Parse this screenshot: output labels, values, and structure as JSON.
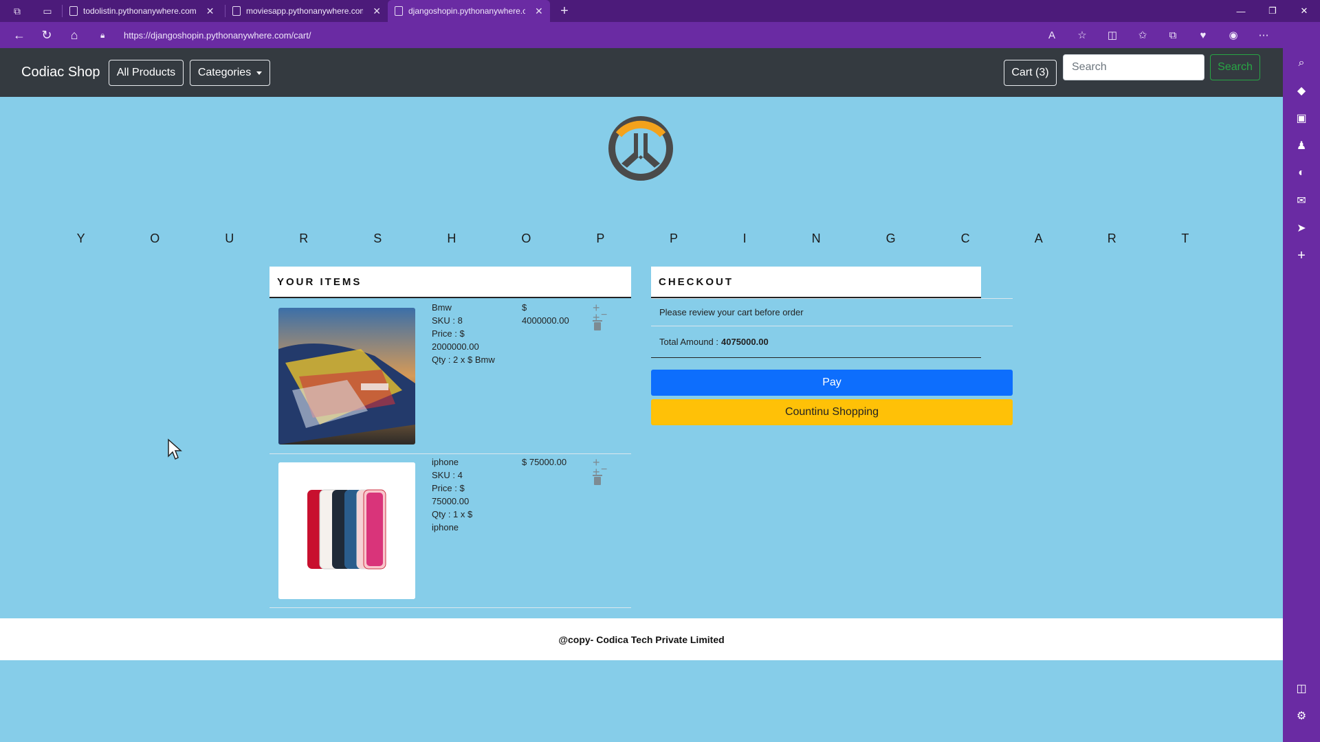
{
  "browser": {
    "tabs": [
      {
        "title": "todolistin.pythonanywhere.com"
      },
      {
        "title": "moviesapp.pythonanywhere.com"
      },
      {
        "title": "djangoshopin.pythonanywhere.c"
      }
    ],
    "url": "https://djangoshopin.pythonanywhere.com/cart/"
  },
  "navbar": {
    "brand": "Codiac Shop",
    "all_products": "All Products",
    "categories": "Categories",
    "cart": "Cart (3)",
    "search_placeholder": "Search",
    "search_button": "Search"
  },
  "main": {
    "title": "Y O U R   S H O P P I N G   C A R T",
    "items_heading": "YOUR ITEMS",
    "items": [
      {
        "name": "Bmw",
        "sku": "SKU : 8",
        "price_label": "Price : $",
        "price_value": "2000000.00",
        "qty": "Qty : 2 x $ Bmw",
        "total_prefix": "$",
        "total": "4000000.00"
      },
      {
        "name": "iphone",
        "sku": "SKU : 4",
        "price_label": "Price : $",
        "price_value": "75000.00",
        "qty": "Qty : 1 x $",
        "qty2": "iphone",
        "total": "$ 75000.00"
      }
    ],
    "checkout": {
      "heading": "CHECKOUT",
      "review": "Please review your cart before order",
      "total_label": "Total Amound : ",
      "total_value": "4075000.00",
      "pay": "Pay",
      "continue": "Countinu Shopping"
    }
  },
  "footer": {
    "text": "@copy- Codica Tech Private Limited"
  },
  "colors": {
    "page_bg": "#86cde9",
    "navbar_bg": "#343a40",
    "pay": "#0d6efd",
    "continue": "#ffc107",
    "browser_frame": "#6a2ba3"
  }
}
